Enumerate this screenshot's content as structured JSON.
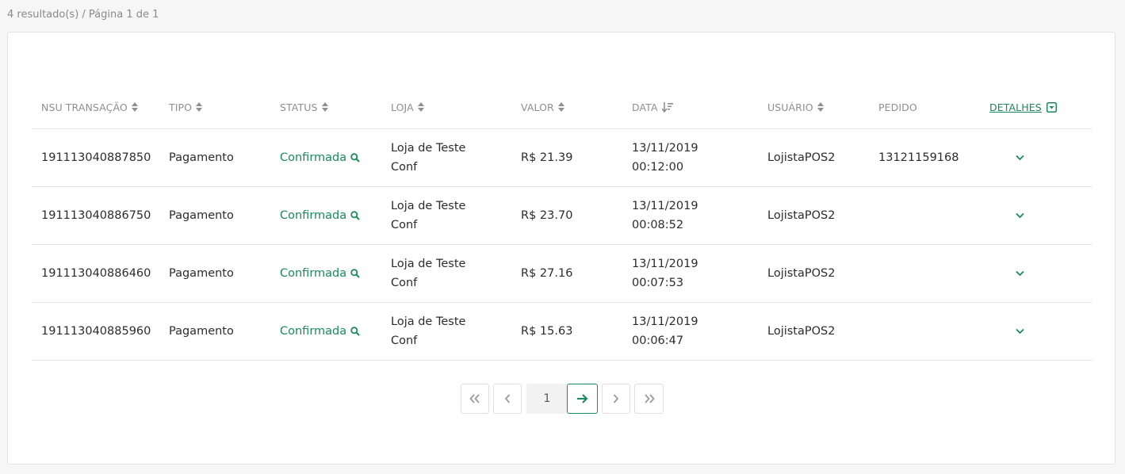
{
  "summary": "4 resultado(s) / Página 1 de 1",
  "columns": {
    "nsu": "NSU TRANSAÇÃO",
    "tipo": "TIPO",
    "status": "STATUS",
    "loja": "LOJA",
    "valor": "VALOR",
    "data": "DATA",
    "usuario": "USUÁRIO",
    "pedido": "PEDIDO",
    "detalhes": "DETALHES"
  },
  "rows": [
    {
      "nsu": "191113040887850",
      "tipo": "Pagamento",
      "status": "Confirmada",
      "loja_1": "Loja de Teste",
      "loja_2": "Conf",
      "valor": "R$ 21.39",
      "data_1": "13/11/2019",
      "data_2": "00:12:00",
      "usuario": "LojistaPOS2",
      "pedido": "13121159168"
    },
    {
      "nsu": "191113040886750",
      "tipo": "Pagamento",
      "status": "Confirmada",
      "loja_1": "Loja de Teste",
      "loja_2": "Conf",
      "valor": "R$ 23.70",
      "data_1": "13/11/2019",
      "data_2": "00:08:52",
      "usuario": "LojistaPOS2",
      "pedido": ""
    },
    {
      "nsu": "191113040886460",
      "tipo": "Pagamento",
      "status": "Confirmada",
      "loja_1": "Loja de Teste",
      "loja_2": "Conf",
      "valor": "R$ 27.16",
      "data_1": "13/11/2019",
      "data_2": "00:07:53",
      "usuario": "LojistaPOS2",
      "pedido": ""
    },
    {
      "nsu": "191113040885960",
      "tipo": "Pagamento",
      "status": "Confirmada",
      "loja_1": "Loja de Teste",
      "loja_2": "Conf",
      "valor": "R$ 15.63",
      "data_1": "13/11/2019",
      "data_2": "00:06:47",
      "usuario": "LojistaPOS2",
      "pedido": ""
    }
  ],
  "pagination": {
    "current_page": "1",
    "icons": [
      "double-chevron-left-icon",
      "chevron-left-icon",
      "arrow-right-icon",
      "chevron-right-icon",
      "double-chevron-right-icon"
    ]
  },
  "colors": {
    "accent": "#1a8a5a",
    "muted_text": "#8f8f8f",
    "border": "#e3e3e3",
    "background": "#f6f6f6"
  },
  "icons": {
    "sort": "sort-icon",
    "sort_desc": "sort-descending-icon",
    "status_search": "magnifier-icon",
    "detalhes_toggle": "dropdown-box-icon",
    "row_expand": "chevron-down-icon"
  }
}
